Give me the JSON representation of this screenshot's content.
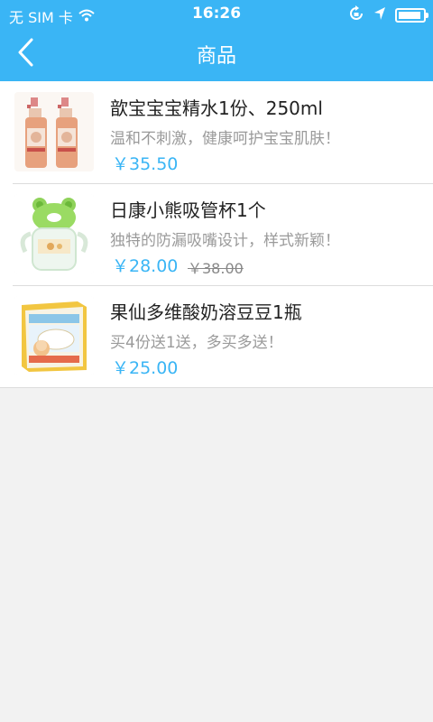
{
  "status_bar": {
    "carrier": "无 SIM 卡",
    "time": "16:26"
  },
  "header": {
    "title": "商品"
  },
  "colors": {
    "accent": "#3ab5f5"
  },
  "products": [
    {
      "name": "歆宝宝宝精水1份、250ml",
      "description": "温和不刺激，健康呵护宝宝肌肤！",
      "price": "￥35.50",
      "original_price": ""
    },
    {
      "name": "日康小熊吸管杯1个",
      "description": "独特的防漏吸嘴设计，样式新颖！",
      "price": "￥28.00",
      "original_price": "￥38.00"
    },
    {
      "name": "果仙多维酸奶溶豆豆1瓶",
      "description": "买4份送1送，多买多送！",
      "price": "￥25.00",
      "original_price": ""
    }
  ]
}
